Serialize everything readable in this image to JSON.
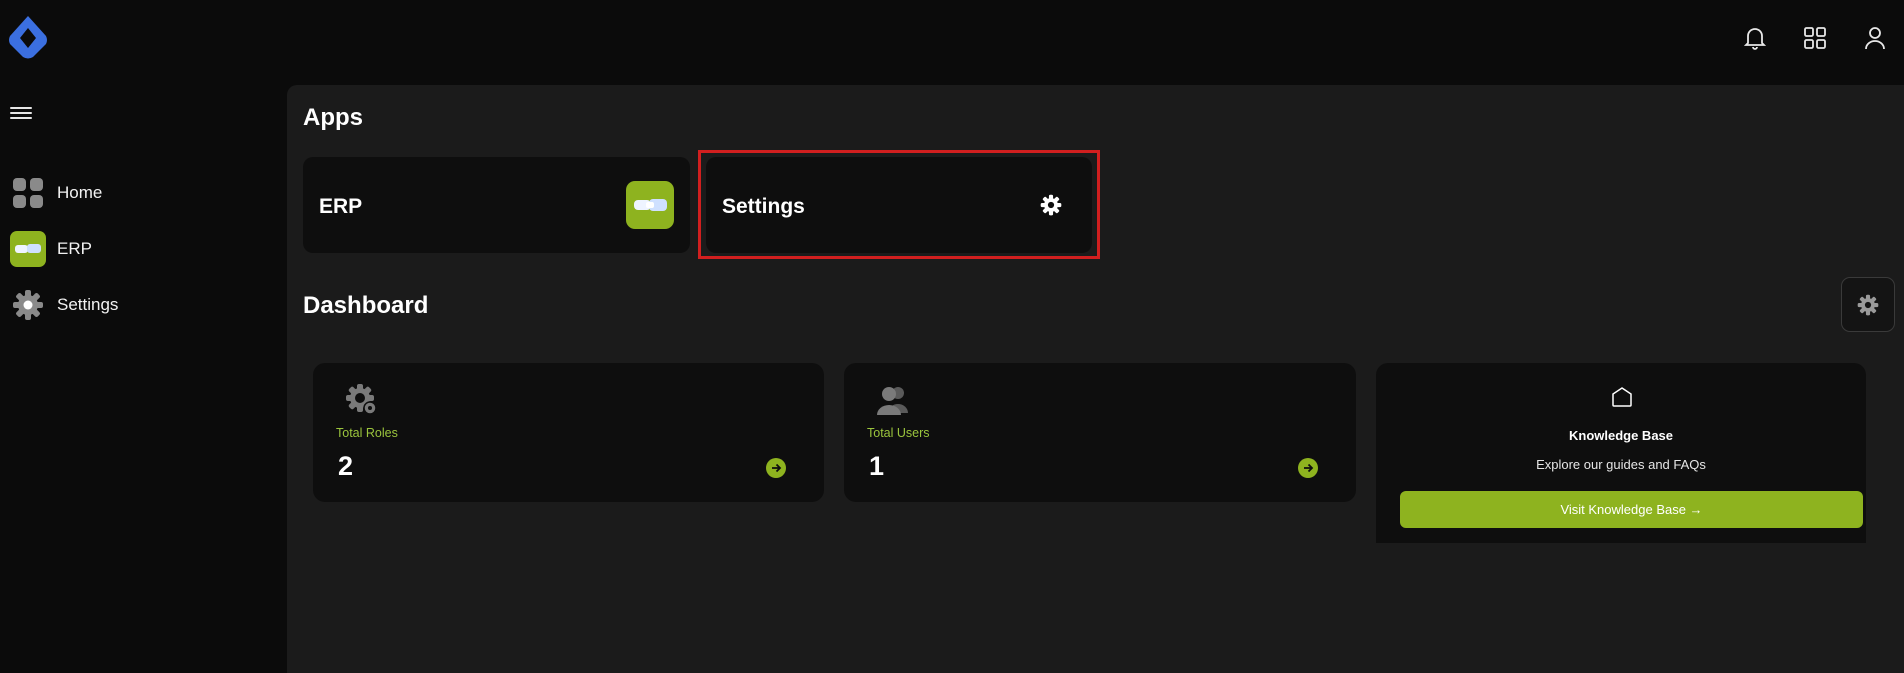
{
  "colors": {
    "accent": "#8eb31f",
    "accent_text": "#9bc53d",
    "highlight_border": "#d11f1f",
    "brand_logo": "#3b6fe0",
    "background": "#0b0b0b",
    "panel": "#1b1b1b",
    "card": "#0e0e0e"
  },
  "header": {
    "logo_icon": "brand-logo-icon",
    "icons": [
      "bell-icon",
      "apps-grid-icon",
      "user-icon"
    ]
  },
  "sidebar": {
    "menu_icon": "hamburger-icon",
    "items": [
      {
        "label": "Home",
        "icon": "home-grid-icon"
      },
      {
        "label": "ERP",
        "icon": "erp-app-icon"
      },
      {
        "label": "Settings",
        "icon": "gear-icon"
      }
    ]
  },
  "apps": {
    "title": "Apps",
    "cards": [
      {
        "name": "ERP",
        "icon": "erp-app-icon"
      },
      {
        "name": "Settings",
        "icon": "gear-icon"
      }
    ]
  },
  "dashboard": {
    "title": "Dashboard",
    "settings_icon": "gear-icon",
    "stats": [
      {
        "label": "Total Roles",
        "value": "2",
        "icon": "roles-gear-icon"
      },
      {
        "label": "Total Users",
        "value": "1",
        "icon": "users-icon"
      }
    ],
    "knowledge_base": {
      "icon": "home-outline-icon",
      "title": "Knowledge Base",
      "description": "Explore our guides and FAQs",
      "button_label": "Visit Knowledge Base →"
    }
  }
}
